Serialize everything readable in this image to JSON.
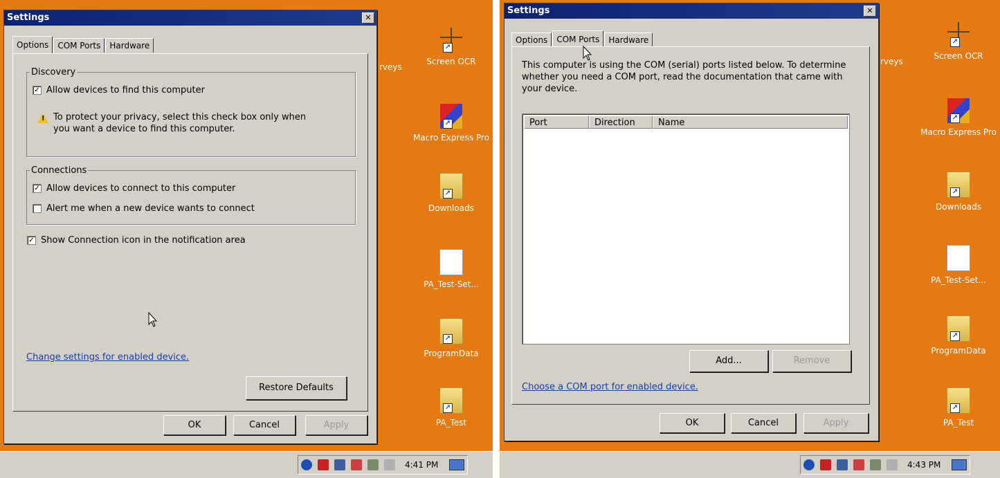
{
  "left": {
    "desktop_icons": [
      {
        "label": "Screen OCR",
        "kind": "crosshair"
      },
      {
        "label": "Macro Express Pro",
        "kind": "mx"
      },
      {
        "label": "Downloads",
        "kind": "folder"
      },
      {
        "label": "PA_Test-Set...",
        "kind": "doc"
      },
      {
        "label": "ProgramData",
        "kind": "folder"
      },
      {
        "label": "PA_Test",
        "kind": "folder"
      }
    ],
    "partial_label": "rveys",
    "dialog": {
      "title": "Settings",
      "close": "✕",
      "tabs": [
        "Options",
        "COM Ports",
        "Hardware"
      ],
      "discovery": {
        "legend": "Discovery",
        "allow_find": "Allow devices to find this computer",
        "warning": "To protect your privacy, select this check box only when you want a device to find this computer."
      },
      "connections": {
        "legend": "Connections",
        "allow_connect": "Allow devices to connect to this computer",
        "alert_connect": "Alert me when a new device wants to connect"
      },
      "show_icon": "Show Connection icon in the notification area",
      "link": "Change settings for enabled device.",
      "restore": "Restore Defaults",
      "ok": "OK",
      "cancel": "Cancel",
      "apply": "Apply"
    },
    "clock": "4:41 PM"
  },
  "right": {
    "desktop_icons": [
      {
        "label": "Screen OCR",
        "kind": "crosshair"
      },
      {
        "label": "Macro Express Pro",
        "kind": "mx"
      },
      {
        "label": "Downloads",
        "kind": "folder"
      },
      {
        "label": "PA_Test-Set...",
        "kind": "doc"
      },
      {
        "label": "ProgramData",
        "kind": "folder"
      },
      {
        "label": "PA_Test",
        "kind": "folder"
      }
    ],
    "partial_label": "rveys",
    "dialog": {
      "title": "Settings",
      "close": "✕",
      "tabs": [
        "Options",
        "COM Ports",
        "Hardware"
      ],
      "description": "This computer is using the COM (serial) ports listed below. To determine whether you need a COM port, read the documentation that came with your device.",
      "columns": [
        "Port",
        "Direction",
        "Name"
      ],
      "add": "Add...",
      "remove": "Remove",
      "link": "Choose a COM port for enabled device.",
      "ok": "OK",
      "cancel": "Cancel",
      "apply": "Apply"
    },
    "clock": "4:43 PM"
  },
  "check_mark": "✓",
  "warn_mark": "!",
  "shortcut_mark": "↗",
  "colors": {
    "desktop": "#e57a12",
    "titlebar": "#0b2270",
    "link": "#1a3ca8"
  }
}
